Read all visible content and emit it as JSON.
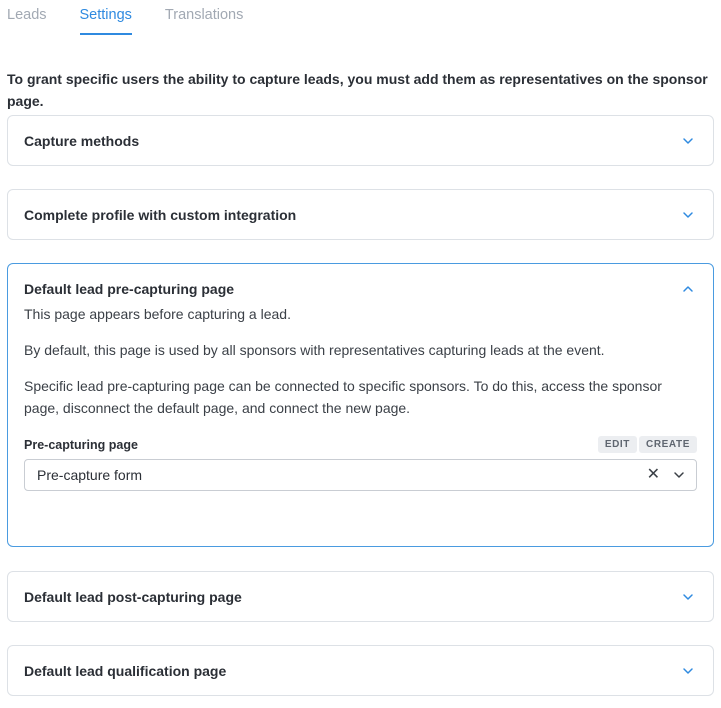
{
  "tabs": [
    {
      "label": "Leads",
      "active": false
    },
    {
      "label": "Settings",
      "active": true
    },
    {
      "label": "Translations",
      "active": false
    }
  ],
  "intro": "To grant specific users the ability to capture leads, you must add them as representatives on the sponsor page.",
  "panels": {
    "capture_methods": {
      "title": "Capture methods",
      "expanded": false
    },
    "custom_integration": {
      "title": "Complete profile with custom integration",
      "expanded": false
    },
    "pre_capturing": {
      "title": "Default lead pre-capturing page",
      "expanded": true,
      "paragraphs": [
        "This page appears before capturing a lead.",
        "By default, this page is used by all sponsors with representatives capturing leads at the event.",
        "Specific lead pre-capturing page can be connected to specific sponsors. To do this, access the sponsor page, disconnect the default page, and connect the new page."
      ],
      "field_label": "Pre-capturing page",
      "edit_label": "EDIT",
      "create_label": "CREATE",
      "selected_value": "Pre-capture form"
    },
    "post_capturing": {
      "title": "Default lead post-capturing page",
      "expanded": false
    },
    "qualification": {
      "title": "Default lead qualification page",
      "expanded": false
    }
  },
  "colors": {
    "accent": "#2f8ae0",
    "border": "#dde1e6",
    "open_border": "#4a9be0"
  },
  "icons": {
    "collapsed": "chevron-down-icon",
    "expanded": "chevron-up-icon",
    "clear": "close-icon"
  }
}
